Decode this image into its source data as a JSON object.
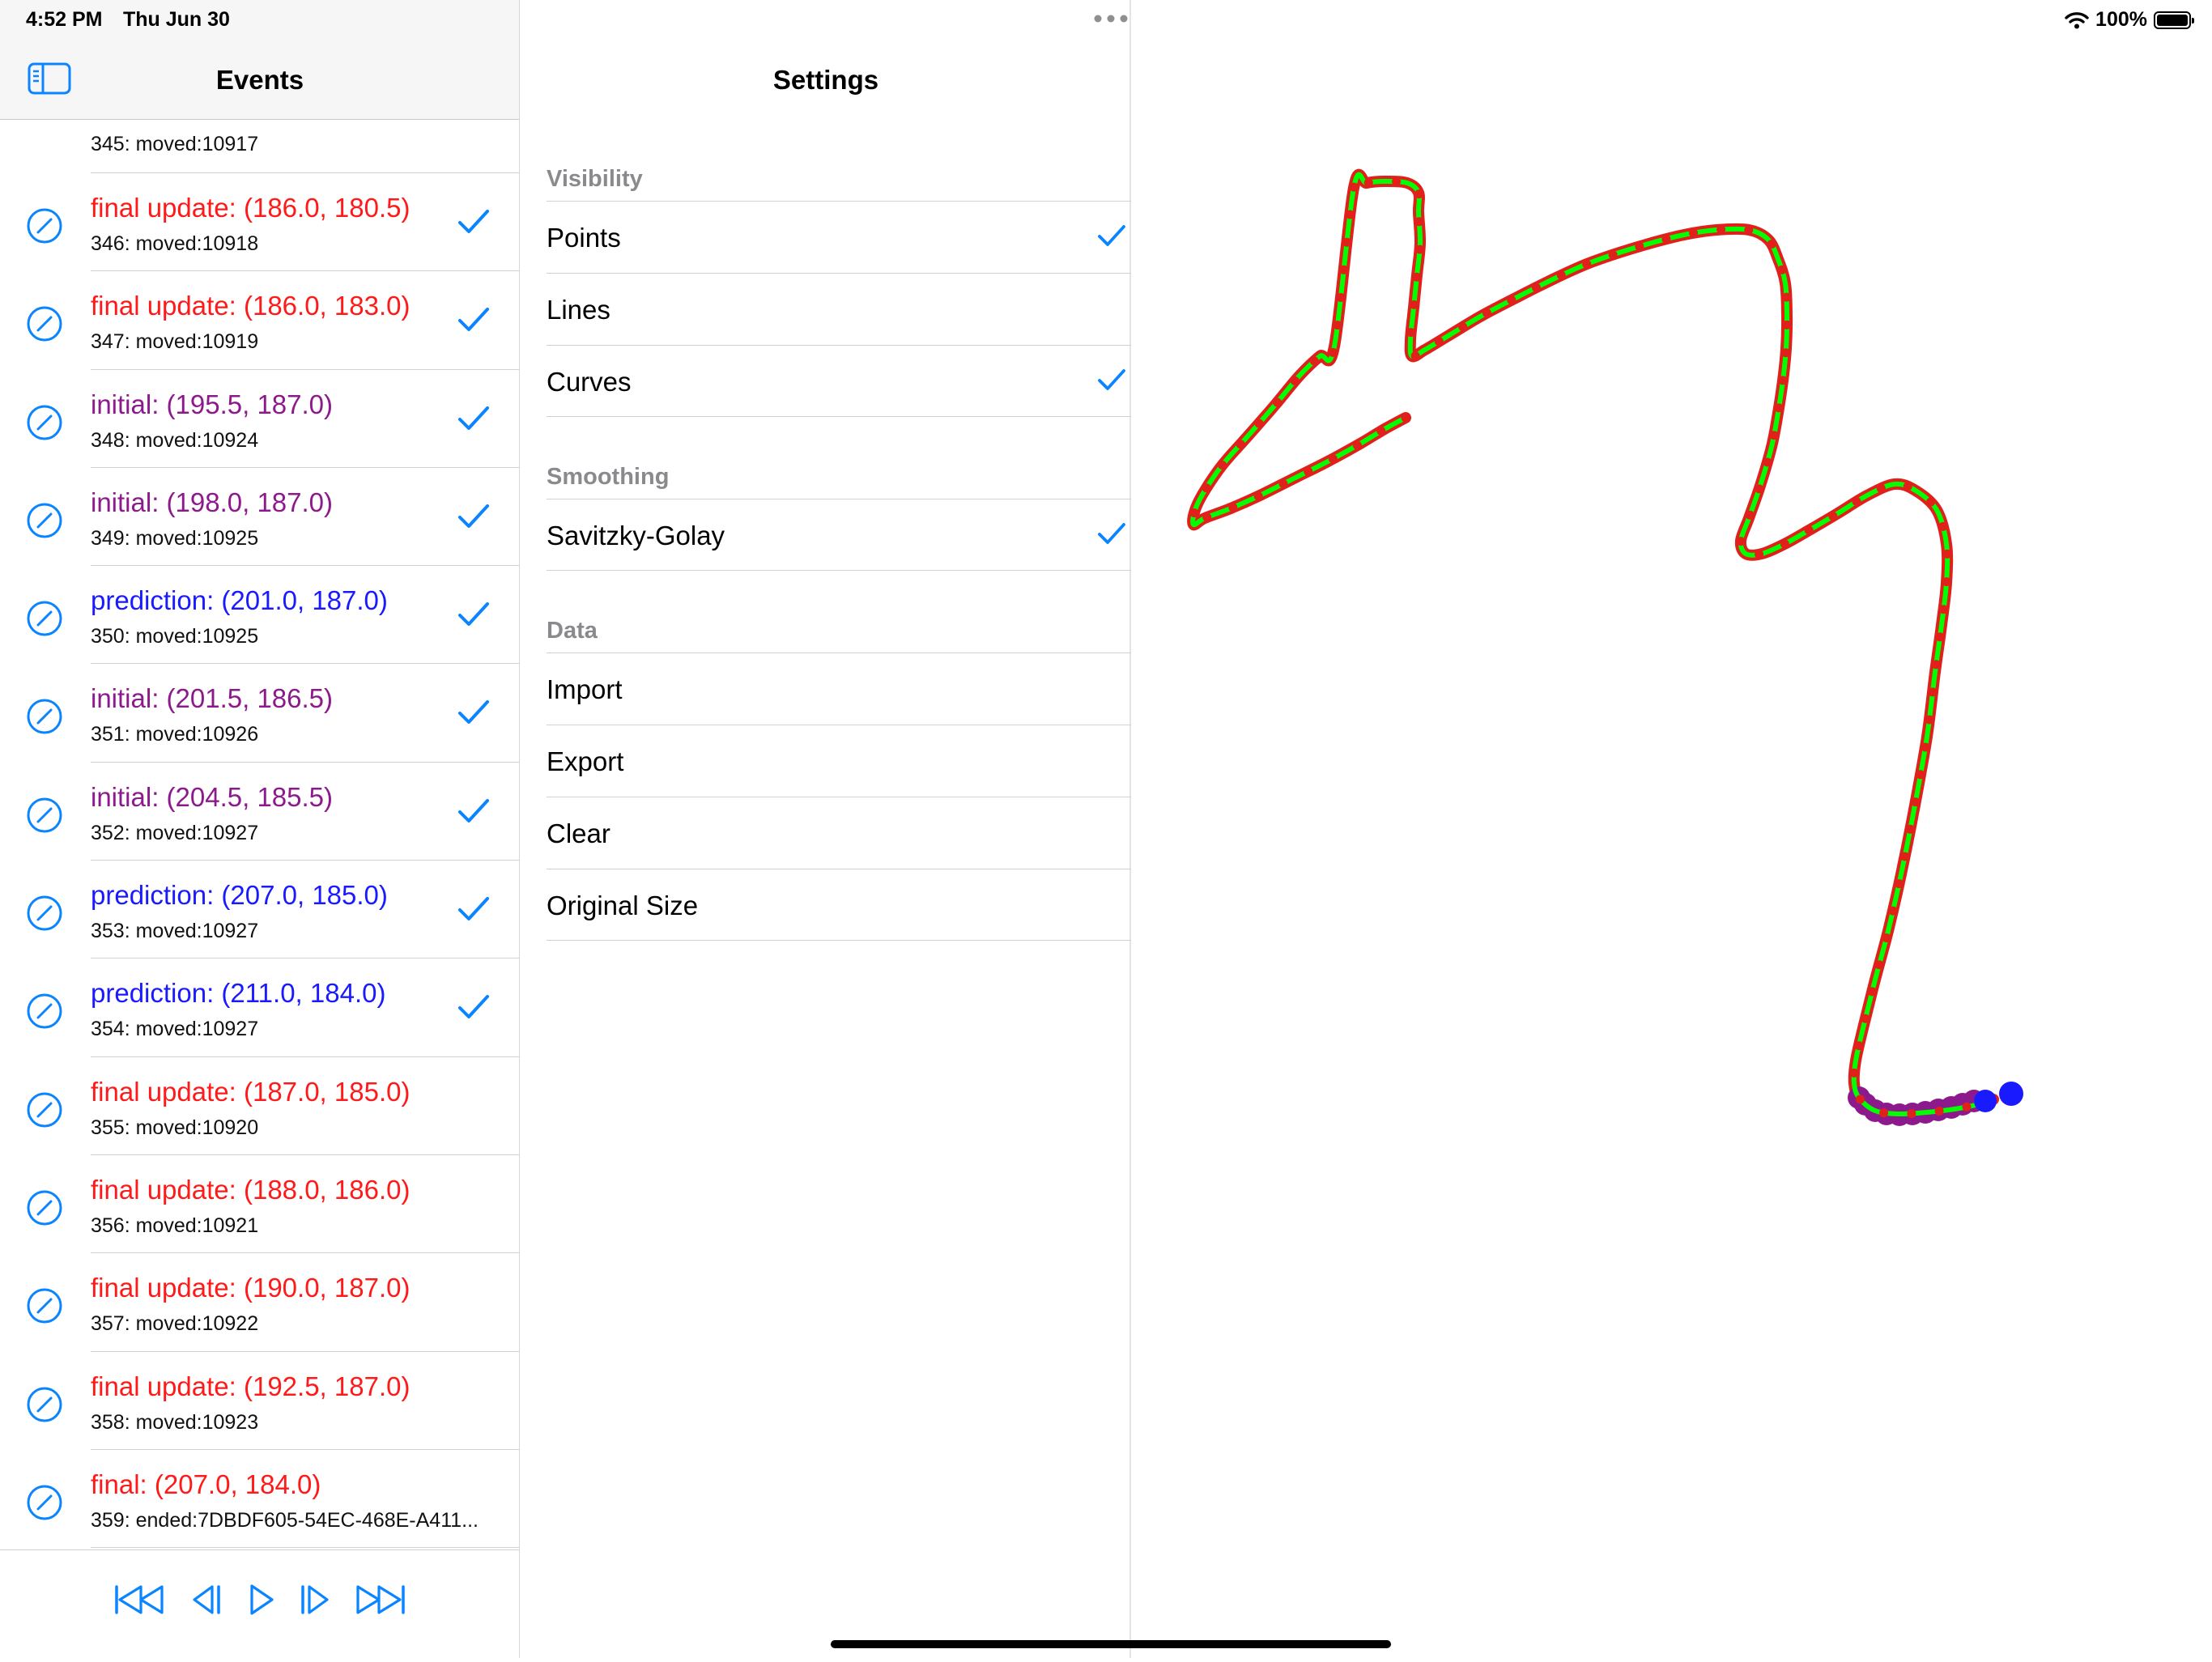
{
  "status_bar": {
    "time": "4:52 PM",
    "date": "Thu Jun 30",
    "battery": "100%"
  },
  "events": {
    "title": "Events",
    "partial_row": {
      "sub": "345: moved:10917"
    },
    "rows": [
      {
        "main": "final update: (186.0, 180.5)",
        "sub": "346: moved:10918",
        "kind": "red",
        "checked": true
      },
      {
        "main": "final update: (186.0, 183.0)",
        "sub": "347: moved:10919",
        "kind": "red",
        "checked": true
      },
      {
        "main": "initial: (195.5, 187.0)",
        "sub": "348: moved:10924",
        "kind": "purple",
        "checked": true
      },
      {
        "main": "initial: (198.0, 187.0)",
        "sub": "349: moved:10925",
        "kind": "purple",
        "checked": true
      },
      {
        "main": "prediction: (201.0, 187.0)",
        "sub": "350: moved:10925",
        "kind": "blue",
        "checked": true
      },
      {
        "main": "initial: (201.5, 186.5)",
        "sub": "351: moved:10926",
        "kind": "purple",
        "checked": true
      },
      {
        "main": "initial: (204.5, 185.5)",
        "sub": "352: moved:10927",
        "kind": "purple",
        "checked": true
      },
      {
        "main": "prediction: (207.0, 185.0)",
        "sub": "353: moved:10927",
        "kind": "blue",
        "checked": true
      },
      {
        "main": "prediction: (211.0, 184.0)",
        "sub": "354: moved:10927",
        "kind": "blue",
        "checked": true
      },
      {
        "main": "final update: (187.0, 185.0)",
        "sub": "355: moved:10920",
        "kind": "red",
        "checked": false
      },
      {
        "main": "final update: (188.0, 186.0)",
        "sub": "356: moved:10921",
        "kind": "red",
        "checked": false
      },
      {
        "main": "final update: (190.0, 187.0)",
        "sub": "357: moved:10922",
        "kind": "red",
        "checked": false
      },
      {
        "main": "final update: (192.5, 187.0)",
        "sub": "358: moved:10923",
        "kind": "red",
        "checked": false
      },
      {
        "main": "final: (207.0, 184.0)",
        "sub": "359: ended:7DBDF605-54EC-468E-A411...",
        "kind": "red",
        "checked": false
      }
    ],
    "transport_icons": [
      "skip-to-start-icon",
      "step-back-icon",
      "play-icon",
      "step-forward-icon",
      "skip-to-end-icon"
    ]
  },
  "settings": {
    "title": "Settings",
    "sections": {
      "visibility": {
        "header": "Visibility",
        "items": [
          {
            "label": "Points",
            "checked": true
          },
          {
            "label": "Lines",
            "checked": false
          },
          {
            "label": "Curves",
            "checked": true
          }
        ]
      },
      "smoothing": {
        "header": "Smoothing",
        "items": [
          {
            "label": "Savitzky-Golay",
            "checked": true
          }
        ]
      },
      "data": {
        "header": "Data",
        "items": [
          {
            "label": "Import"
          },
          {
            "label": "Export"
          },
          {
            "label": "Clear"
          },
          {
            "label": "Original Size"
          }
        ]
      }
    }
  },
  "colors": {
    "accent": "#0a84ff",
    "final_update": "#ff1a1a",
    "initial": "#8d1a8d",
    "prediction": "#1a1aff",
    "curve": "#00ff00",
    "points": "#e0201a"
  }
}
